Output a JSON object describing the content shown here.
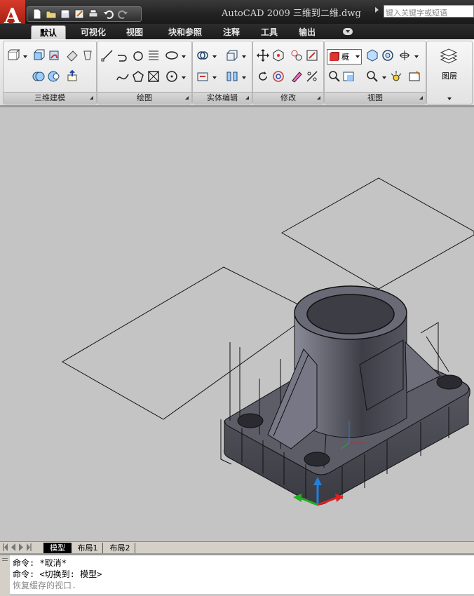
{
  "titlebar": {
    "app_logo": "A",
    "title": "AutoCAD 2009  三维到二维.dwg",
    "search_placeholder": "键入关键字或短语",
    "quick_access": [
      "new-icon",
      "open-icon",
      "save-icon",
      "saveas-icon",
      "plot-icon",
      "undo-icon",
      "redo-icon"
    ]
  },
  "tabs": [
    "默认",
    "可视化",
    "视图",
    "块和参照",
    "注释",
    "工具",
    "输出"
  ],
  "active_tab": "默认",
  "panels": {
    "modeling": "三维建模",
    "draw": "绘图",
    "solid_edit": "实体编辑",
    "modify": "修改",
    "view": "视图",
    "layers": "图层"
  },
  "view_style_label": "概",
  "layout_tabs": [
    "模型",
    "布局1",
    "布局2"
  ],
  "command_lines": [
    "命令: *取消*",
    "命令:  <切换到: 模型>",
    "恢复缓存的视口."
  ],
  "colors": {
    "axis_x": "#e02020",
    "axis_y": "#20b020",
    "axis_z": "#2080e0",
    "model": "#4a4a52"
  }
}
